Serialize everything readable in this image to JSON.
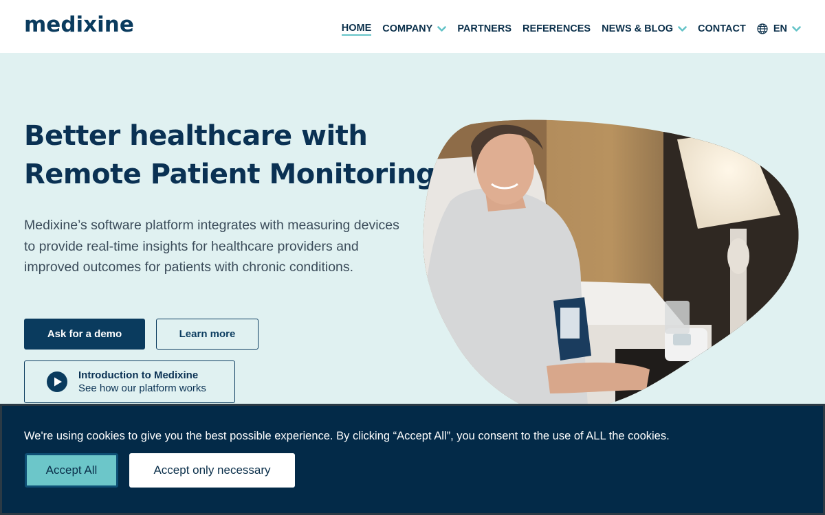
{
  "brand": {
    "logo_text": "medixine",
    "primary": "#0a3b5e",
    "accent": "#63c3c7",
    "background": "#e0f1f1"
  },
  "nav": {
    "items": [
      {
        "label": "HOME",
        "active": true,
        "dropdown": false
      },
      {
        "label": "COMPANY",
        "active": false,
        "dropdown": true
      },
      {
        "label": "PARTNERS",
        "active": false,
        "dropdown": false
      },
      {
        "label": "REFERENCES",
        "active": false,
        "dropdown": false
      },
      {
        "label": "NEWS & BLOG",
        "active": false,
        "dropdown": true
      },
      {
        "label": "CONTACT",
        "active": false,
        "dropdown": false
      }
    ],
    "language": {
      "label": "EN",
      "icon": "globe-icon"
    }
  },
  "hero": {
    "title_line1": "Better healthcare with",
    "title_line2": "Remote Patient Monitoring",
    "description": "Medixine’s software platform integrates with measuring devices to provide real-time insights for healthcare providers and improved outcomes for patients with chronic conditions.",
    "demo_button": "Ask for a demo",
    "learn_button": "Learn more",
    "intro": {
      "title": "Introduction to Medixine",
      "subtitle": "See how our platform works",
      "icon": "play-icon"
    }
  },
  "cookie": {
    "message": "We're using cookies to give you the best possible experience. By clicking “Accept All”, you consent to the use of ALL the cookies.",
    "accept_all": "Accept All",
    "accept_necessary": "Accept only necessary"
  }
}
